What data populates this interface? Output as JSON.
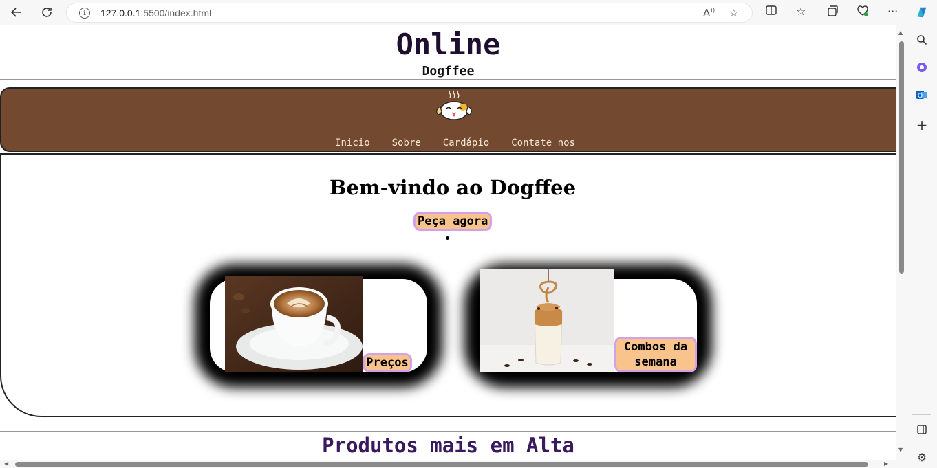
{
  "browser": {
    "url_host": "127.0.0.1",
    "url_path": ":5500/index.html"
  },
  "site": {
    "title": "Online",
    "subtitle": "Dogffee",
    "menu": [
      "Inicio",
      "Sobre",
      "Cardápio",
      "Contate nos"
    ],
    "hero_title": "Bem-vindo ao Dogffee",
    "order_button": "Peça agora",
    "cards": [
      {
        "button": "Preços",
        "image": "latte-art-coffee-cup"
      },
      {
        "button": "Combos da semana",
        "image": "dalgona-coffee-glass"
      }
    ],
    "section_title": "Produtos mais em Alta"
  },
  "colors": {
    "header_brown": "#734a2f",
    "button_fill": "#f9c48c",
    "button_border": "#d3a0ea",
    "title_purple": "#3a1a5e"
  }
}
